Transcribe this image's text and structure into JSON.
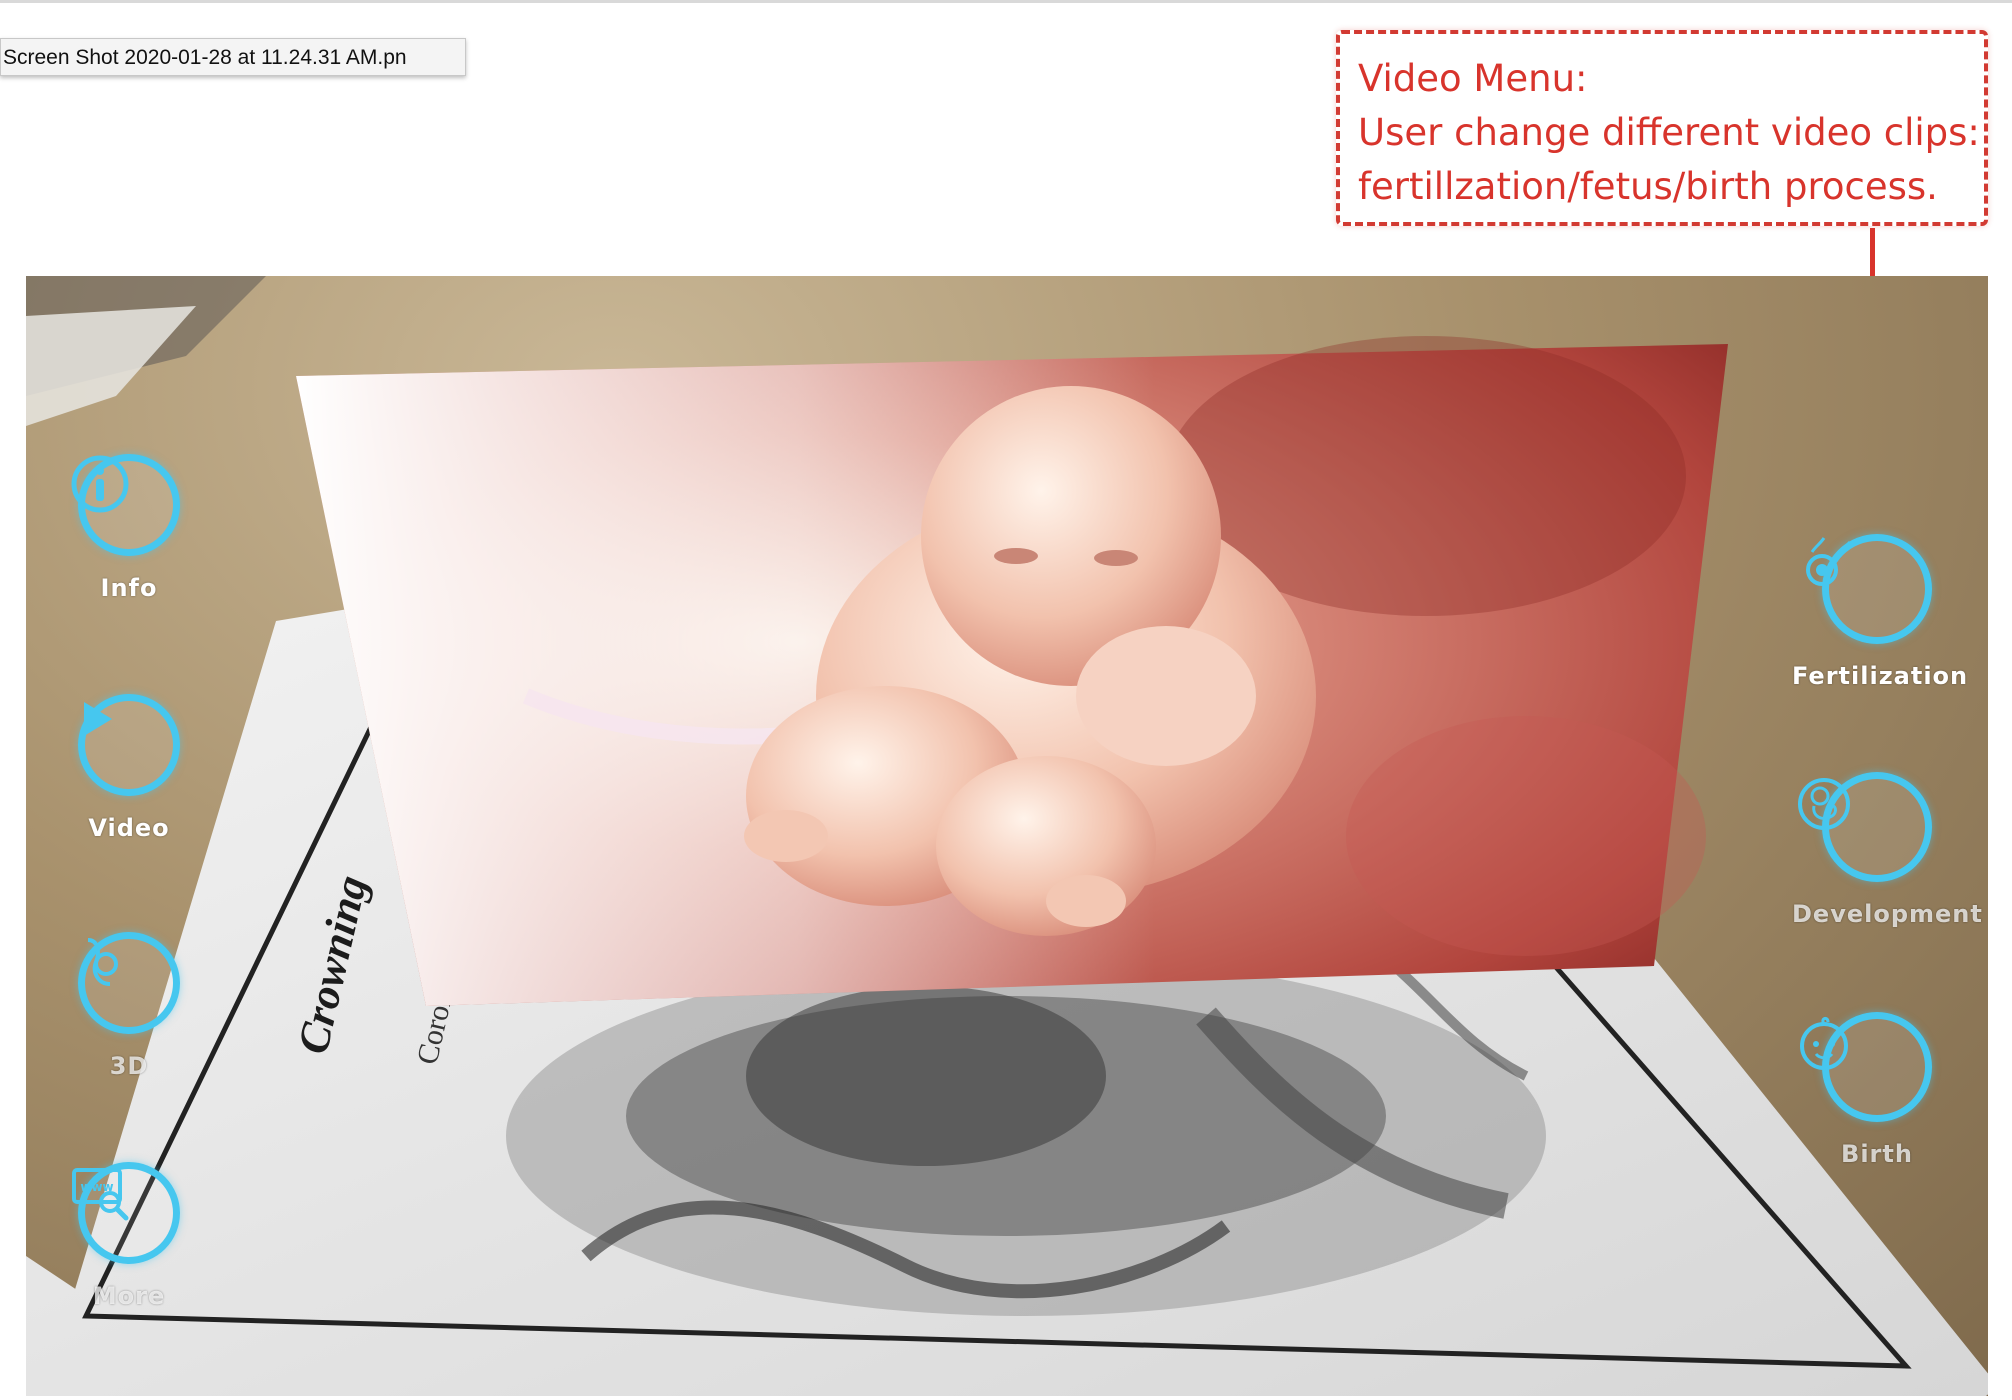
{
  "tooltip": {
    "filename": "Screen Shot 2020-01-28 at 11.24.31 AM.pn"
  },
  "annotation": {
    "line1": "Video Menu:",
    "line2": "User change different video clips:",
    "line3": "fertillzation/fetus/birth process.",
    "color": "#d8342c"
  },
  "ar_app": {
    "left_menu": [
      {
        "label": "Info",
        "icon": "info-icon"
      },
      {
        "label": "Video",
        "icon": "play-icon"
      },
      {
        "label": "3D",
        "icon": "3d-anatomy-icon"
      },
      {
        "label": "More",
        "icon": "web-search-icon"
      }
    ],
    "right_menu": [
      {
        "label": "Fertilization",
        "icon": "fertilization-icon"
      },
      {
        "label": "Development",
        "icon": "fetus-icon"
      },
      {
        "label": "Birth",
        "icon": "baby-face-icon"
      }
    ],
    "paper_title": "Crowning",
    "paper_subtitle": "Coron",
    "accent_color": "#46c7ef"
  }
}
